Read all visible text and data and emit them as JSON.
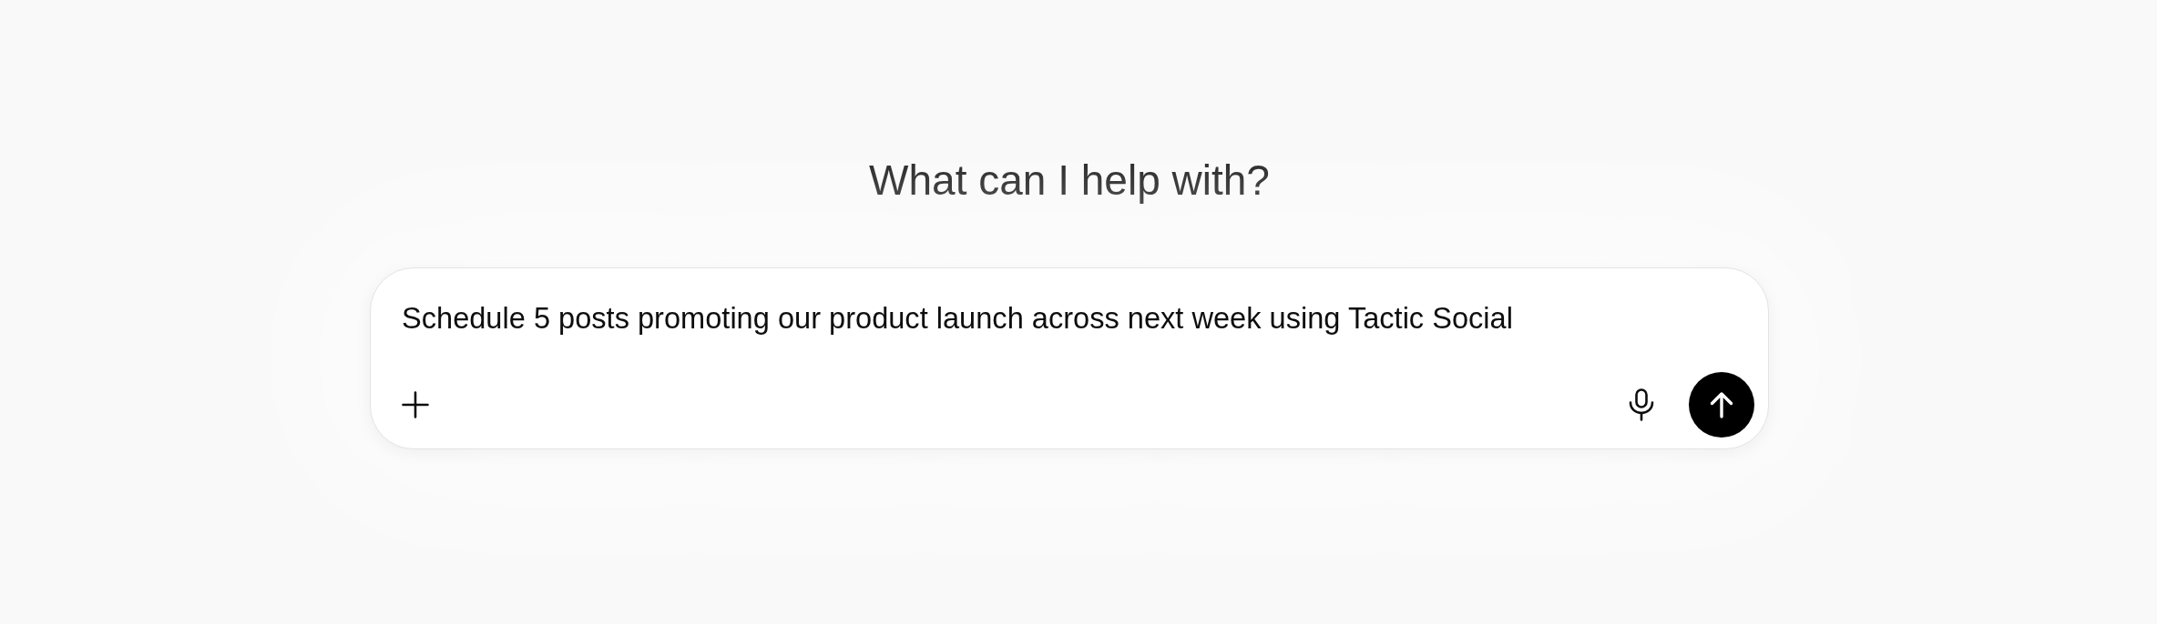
{
  "heading": "What can I help with?",
  "composer": {
    "value": "Schedule 5 posts promoting our product launch across next week using Tactic Social"
  }
}
